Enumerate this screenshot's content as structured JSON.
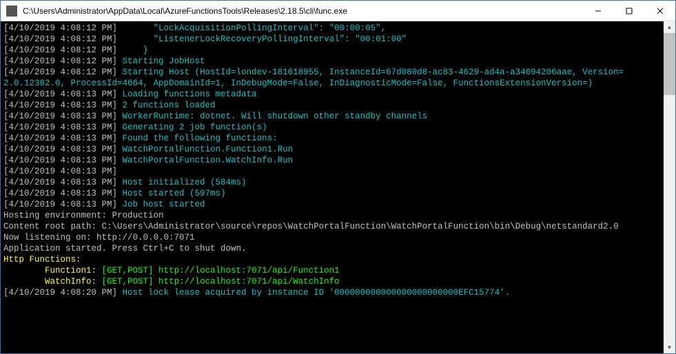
{
  "titlebar": {
    "path": "C:\\Users\\Administrator\\AppData\\Local\\AzureFunctionsTools\\Releases\\2.18.5\\cli\\func.exe"
  },
  "lines": [
    {
      "ts": "[4/10/2019 4:08:12 PM] ",
      "body": "      \"LockAcquisitionPollingInterval\": \"00:00:05\",",
      "color": "cyan"
    },
    {
      "ts": "[4/10/2019 4:08:12 PM] ",
      "body": "      \"ListenerLockRecoveryPollingInterval\": \"00:01:00\"",
      "color": "cyan"
    },
    {
      "ts": "[4/10/2019 4:08:12 PM] ",
      "body": "    }",
      "color": "cyan"
    },
    {
      "ts": "[4/10/2019 4:08:12 PM] ",
      "body": "Starting JobHost",
      "color": "teal"
    },
    {
      "ts": "[4/10/2019 4:08:12 PM] ",
      "body": "Starting Host (HostId=londev-181618955, InstanceId=67d080d8-ac83-4629-ad4a-a34694206aae, Version=",
      "color": "teal"
    },
    {
      "ts": "",
      "body": "2.0.12382.0, ProcessId=4664, AppDomainId=1, InDebugMode=False, InDiagnosticMode=False, FunctionsExtensionVersion=)",
      "color": "teal"
    },
    {
      "ts": "[4/10/2019 4:08:13 PM] ",
      "body": "Loading functions metadata",
      "color": "teal"
    },
    {
      "ts": "[4/10/2019 4:08:13 PM] ",
      "body": "2 functions loaded",
      "color": "teal"
    },
    {
      "ts": "[4/10/2019 4:08:13 PM] ",
      "body": "WorkerRuntime: dotnet. Will shutdown other standby channels",
      "color": "teal"
    },
    {
      "ts": "[4/10/2019 4:08:13 PM] ",
      "body": "Generating 2 job function(s)",
      "color": "teal"
    },
    {
      "ts": "[4/10/2019 4:08:13 PM] ",
      "body": "Found the following functions:",
      "color": "teal"
    },
    {
      "ts": "[4/10/2019 4:08:13 PM] ",
      "body": "WatchPortalFunction.Function1.Run",
      "color": "teal"
    },
    {
      "ts": "[4/10/2019 4:08:13 PM] ",
      "body": "WatchPortalFunction.WatchInfo.Run",
      "color": "teal"
    },
    {
      "ts": "[4/10/2019 4:08:13 PM] ",
      "body": "",
      "color": "teal"
    },
    {
      "ts": "[4/10/2019 4:08:13 PM] ",
      "body": "Host initialized (584ms)",
      "color": "teal"
    },
    {
      "ts": "[4/10/2019 4:08:13 PM] ",
      "body": "Host started (597ms)",
      "color": "teal"
    },
    {
      "ts": "[4/10/2019 4:08:13 PM] ",
      "body": "Job host started",
      "color": "teal"
    },
    {
      "ts": "",
      "body": "Hosting environment: Production",
      "color": "gray"
    },
    {
      "ts": "",
      "body": "Content root path: C:\\Users\\Administrator\\source\\repos\\WatchPortalFunction\\WatchPortalFunction\\bin\\Debug\\netstandard2.0",
      "color": "gray"
    },
    {
      "ts": "",
      "body": "Now listening on: http://0.0.0.0:7071",
      "color": "gray"
    },
    {
      "ts": "",
      "body": "Application started. Press Ctrl+C to shut down.",
      "color": "gray"
    },
    {
      "ts": "",
      "body": "",
      "color": "gray"
    },
    {
      "ts": "",
      "body": "Http Functions:",
      "color": "yellow"
    },
    {
      "ts": "",
      "body": "",
      "color": "gray"
    }
  ],
  "functions": [
    {
      "name": "Function1",
      "methods": "[GET,POST]",
      "url": "http://localhost:7071/api/Function1"
    },
    {
      "name": "WatchInfo",
      "methods": "[GET,POST]",
      "url": "http://localhost:7071/api/WatchInfo"
    }
  ],
  "final": {
    "ts": "[4/10/2019 4:08:20 PM] ",
    "body": "Host lock lease acquired by instance ID '000000000000000000000000EFC15774'.",
    "color": "teal"
  }
}
